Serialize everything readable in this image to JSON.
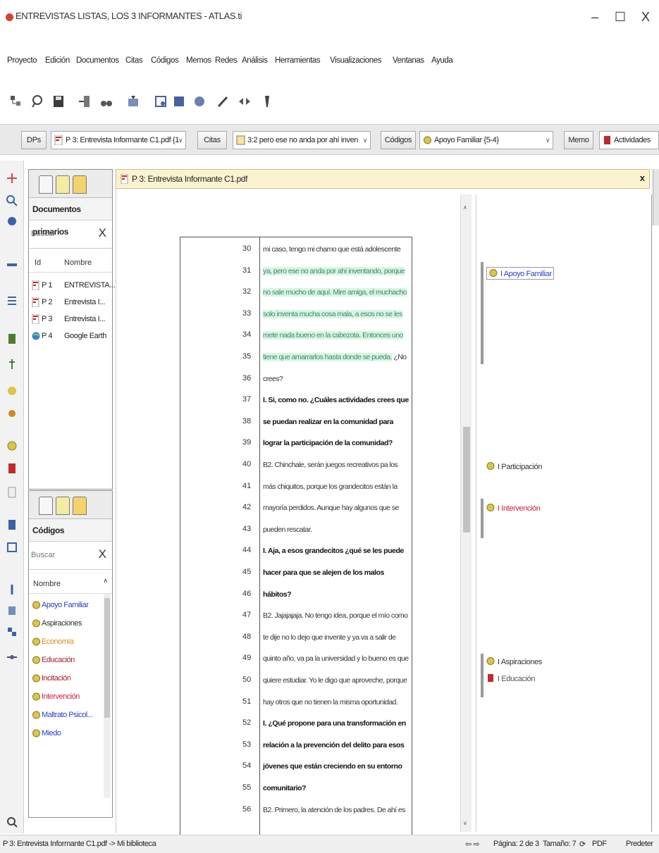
{
  "window": {
    "title": "ENTREVISTAS LISTAS, LOS 3 INFORMANTES - ATLAS.ti",
    "minimize": "–",
    "maximize": "☐",
    "close": "X"
  },
  "menubar": [
    "Proyecto",
    "Edición",
    "Documentos",
    "Citas",
    "Códigos",
    "Memos",
    "Redes",
    "Análisis",
    "Herramientas",
    "Visualizaciones",
    "Ventanas",
    "Ayuda"
  ],
  "managerbar": {
    "dps_button": "DPs",
    "dps_combo": "P 3: Entrevista Informante C1.pdf {1",
    "citas_button": "Citas",
    "citas_combo": "3:2 pero ese no anda por ahí inven",
    "codigos_button": "Códigos",
    "codigos_combo": "Apoyo Familiar {5-4}",
    "memo_button": "Memo",
    "memo_combo": "Actividades"
  },
  "primary_docs": {
    "title": "Documentos primarios",
    "search_placeholder": "Buscar",
    "col_id": "Id",
    "col_name": "Nombre",
    "rows": [
      {
        "id": "P 1",
        "name": "ENTREVISTA..."
      },
      {
        "id": "P 2",
        "name": "Entrevista I..."
      },
      {
        "id": "P 3",
        "name": "Entrevista I..."
      },
      {
        "id": "P 4",
        "name": "Google Earth"
      }
    ]
  },
  "codes_panel": {
    "title": "Códigos",
    "search_placeholder": "Buscar",
    "col_name": "Nombre",
    "items": [
      {
        "label": "Apoyo Familiar",
        "color": "#2a3fd0"
      },
      {
        "label": "Aspiraciones",
        "color": "#333333"
      },
      {
        "label": "Economía",
        "color": "#e08a1e"
      },
      {
        "label": "Educación",
        "color": "#a61f2a"
      },
      {
        "label": "Incitación",
        "color": "#a61f2a"
      },
      {
        "label": "Intervención",
        "color": "#d01f3c"
      },
      {
        "label": "Maltrato Psicol...",
        "color": "#2a3fd0"
      },
      {
        "label": "Miedo",
        "color": "#2a3fd0"
      }
    ]
  },
  "document": {
    "tab_title": "P 3: Entrevista Informante C1.pdf",
    "tab_close": "x",
    "lines": [
      {
        "n": "30",
        "text": "mi caso, tengo mi chamo que está adolescente",
        "bold": false,
        "hl": false
      },
      {
        "n": "31",
        "text": "ya, pero ese no anda por ahí inventando, porque",
        "bold": false,
        "hl": true
      },
      {
        "n": "32",
        "text": "no sale mucho de aquí. Mire amiga, el muchacho",
        "bold": false,
        "hl": true
      },
      {
        "n": "33",
        "text": "solo inventa mucha cosa mala, a esos no se les",
        "bold": false,
        "hl": true
      },
      {
        "n": "34",
        "text": "mete nada bueno en la cabezota. Entonces uno",
        "bold": false,
        "hl": true
      },
      {
        "n": "35",
        "text": "tiene que amarrarlos hasta donde se pueda.",
        "tail": " ¿No",
        "bold": false,
        "hl": true
      },
      {
        "n": "36",
        "text": "crees?",
        "bold": false,
        "hl": false
      },
      {
        "n": "37",
        "text": "I. Si, como no. ¿Cuáles actividades crees que",
        "bold": true,
        "hl": false
      },
      {
        "n": "38",
        "text": "se puedan realizar en la comunidad para",
        "bold": true,
        "hl": false
      },
      {
        "n": "39",
        "text": "lograr la participación de la comunidad?",
        "bold": true,
        "hl": false
      },
      {
        "n": "40",
        "text": "B2. Chinchale, serán juegos recreativos pa los",
        "bold": false,
        "hl": false
      },
      {
        "n": "41",
        "text": "más chiquitos, porque los grandecitos están la",
        "bold": false,
        "hl": false
      },
      {
        "n": "42",
        "text": "mayoría perdidos. Aunque hay algunos que se",
        "bold": false,
        "hl": false
      },
      {
        "n": "43",
        "text": "pueden rescatar.",
        "bold": false,
        "hl": false
      },
      {
        "n": "44",
        "text": "I. Aja, a esos grandecitos ¿qué se les puede",
        "bold": true,
        "hl": false
      },
      {
        "n": "45",
        "text": "hacer para que se alejen de los malos",
        "bold": true,
        "hl": false
      },
      {
        "n": "46",
        "text": "hábitos?",
        "bold": true,
        "hl": false
      },
      {
        "n": "47",
        "text": "B2. Jajajajaja. No tengo idea, porque el mío como",
        "bold": false,
        "hl": false
      },
      {
        "n": "48",
        "text": "te dije no lo dejo que invente y ya va a salir de",
        "bold": false,
        "hl": false
      },
      {
        "n": "49",
        "text": "quinto año, va pa la universidad y lo bueno es que",
        "bold": false,
        "hl": false
      },
      {
        "n": "50",
        "text": "quiere estudiar. Yo le digo que aproveche, porque",
        "bold": false,
        "hl": false
      },
      {
        "n": "51",
        "text": "hay otros que no tienen la misma oportunidad.",
        "bold": false,
        "hl": false
      },
      {
        "n": "52",
        "text": "I. ¿Qué propone para una transformación en",
        "bold": true,
        "hl": false
      },
      {
        "n": "53",
        "text": "relación a la prevención del delito para esos",
        "bold": true,
        "hl": false
      },
      {
        "n": "54",
        "text": "jóvenes que están creciendo en su entorno",
        "bold": true,
        "hl": false
      },
      {
        "n": "55",
        "text": "comunitario?",
        "bold": true,
        "hl": false
      },
      {
        "n": "56",
        "text": "B2. Primero, la atención de los padres. De ahí es",
        "bold": false,
        "hl": false
      }
    ]
  },
  "margin": {
    "codes": [
      {
        "label": "I Apoyo Familiar",
        "color": "#2a3fd0"
      },
      {
        "label": "I Participación",
        "color": "#333333"
      },
      {
        "label": "I Intervención",
        "color": "#d01f3c"
      },
      {
        "label": "I Aspiraciones",
        "color": "#333333"
      },
      {
        "label": "I Educación",
        "color": "#555555"
      }
    ]
  },
  "statusbar": {
    "path": "P 3: Entrevista Informante C1.pdf -> Mi biblioteca",
    "page": "Página: 2 de 3",
    "size": "Tamaño: 7",
    "format": "PDF",
    "zoom": "Predeter"
  },
  "colors": {
    "highlight_bg": "#d9f5e7",
    "highlight_text": "#3a8c62",
    "doc_tab_bg": "#fbf3cf",
    "code_icon": "#d9c64a"
  }
}
